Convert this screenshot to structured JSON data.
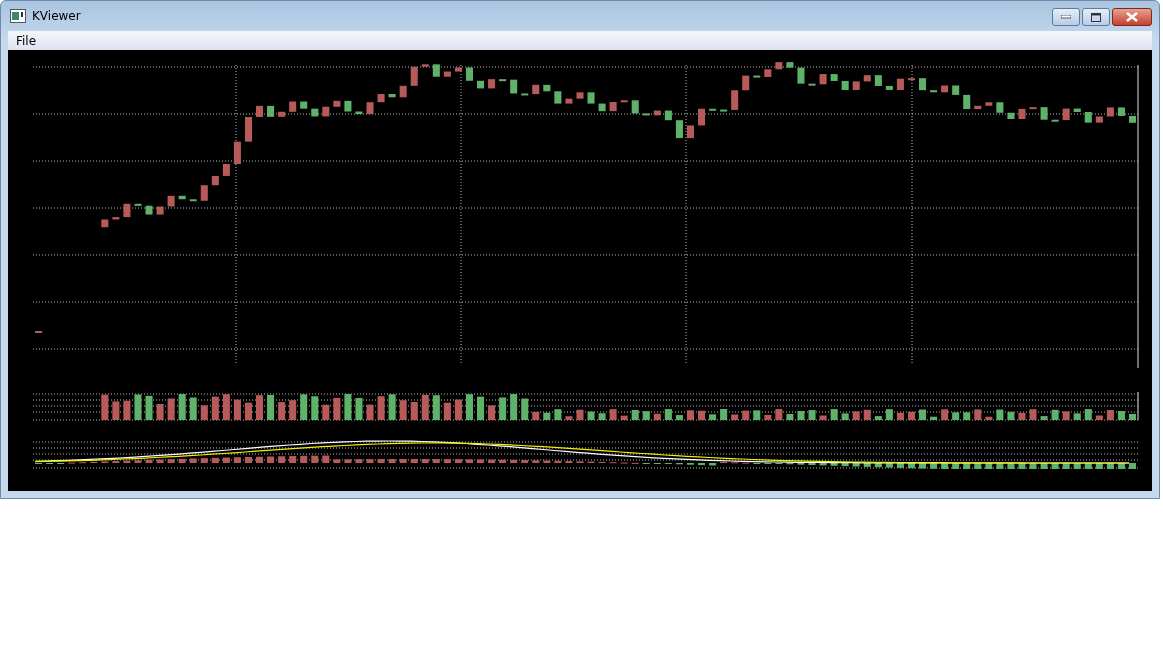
{
  "window": {
    "title": "KViewer"
  },
  "menu": [
    {
      "label": "File"
    }
  ]
}
